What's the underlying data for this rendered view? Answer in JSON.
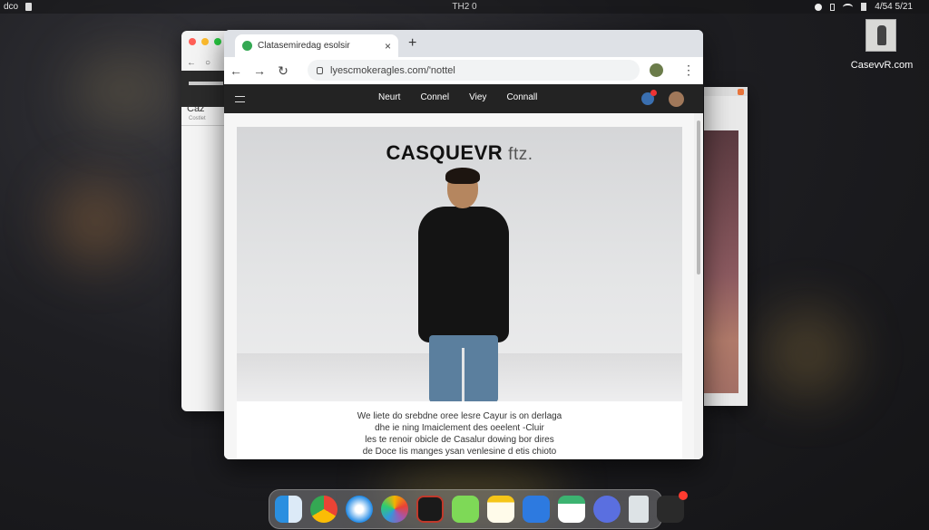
{
  "menubar": {
    "app_name": "dco",
    "center_text": "TH2 0",
    "clock": "4/54 5/21"
  },
  "desktop": {
    "icon_label": "CasevvR.com"
  },
  "back_window": {
    "topbar_text": "",
    "content_title": "Caz",
    "content_sub": "Costlet"
  },
  "browser": {
    "tab_title": "Clatasemiredag esolsir",
    "tab_close": "×",
    "new_tab": "+",
    "back": "←",
    "forward": "→",
    "reload": "↻",
    "url": "lyescmokeragles.com/'nottel",
    "menu": "⋮"
  },
  "site": {
    "nav": [
      "Neurt",
      "Connel",
      "Viey",
      "Connall"
    ],
    "brand": "CASQUEVR",
    "brand_suffix": "ftz.",
    "caption": [
      "We liete do srebdne oree lesre Cayur is on derlaga",
      "dhe ie ning Imaiclement des oeelent -Cluir",
      "les te renoir obicle de Casalur dowing bor dires",
      "de Doce Iis manges ysan venlesine d etis chioto"
    ]
  },
  "dock": {
    "apps": [
      "finder",
      "chrome",
      "safari",
      "photos",
      "game",
      "messages",
      "notes",
      "keynote",
      "calendar",
      "app-store",
      "trash",
      "camera"
    ]
  }
}
